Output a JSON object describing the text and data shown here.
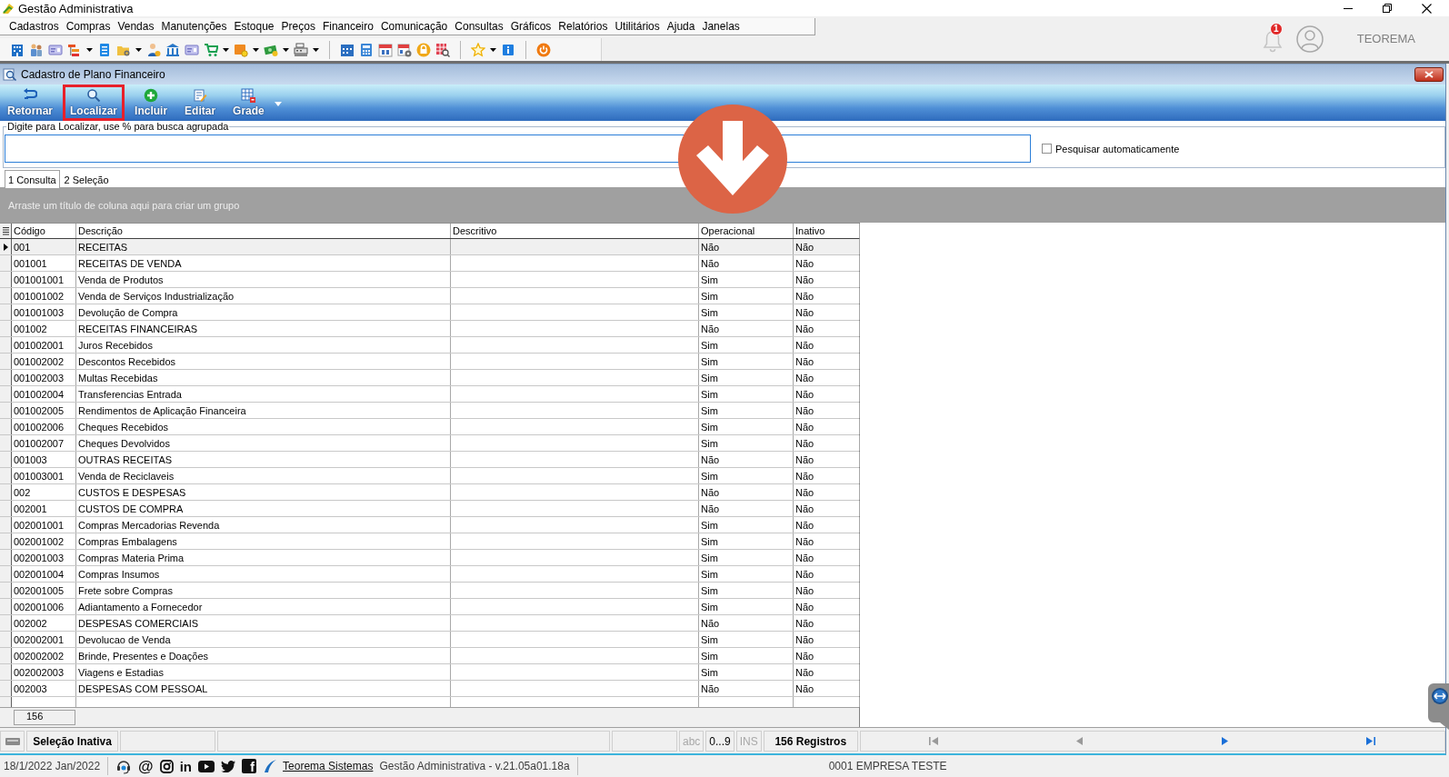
{
  "window": {
    "title": "Gestão Administrativa"
  },
  "menu": [
    "Cadastros",
    "Compras",
    "Vendas",
    "Manutenções",
    "Estoque",
    "Preços",
    "Financeiro",
    "Comunicação",
    "Consultas",
    "Gráficos",
    "Relatórios",
    "Utilitários",
    "Ajuda",
    "Janelas"
  ],
  "account": {
    "notifications": "1",
    "user": "TEOREMA"
  },
  "child_window": {
    "title": "Cadastro de Plano Financeiro"
  },
  "ribbon": [
    {
      "label": "Retornar",
      "highlighted": false,
      "dropdown": false
    },
    {
      "label": "Localizar",
      "highlighted": true,
      "dropdown": false
    },
    {
      "label": "Incluir",
      "highlighted": false,
      "dropdown": false
    },
    {
      "label": "Editar",
      "highlighted": false,
      "dropdown": false
    },
    {
      "label": "Grade",
      "highlighted": false,
      "dropdown": true
    }
  ],
  "search": {
    "legend": "Digite para Localizar, use % para busca agrupada",
    "auto_search": {
      "label": "Pesquisar automaticamente",
      "checked": false
    }
  },
  "tabs": [
    {
      "label": "1 Consulta",
      "selected": true
    },
    {
      "label": "2 Seleção",
      "selected": false
    }
  ],
  "group_panel": {
    "hint": "Arraste um título de coluna aqui para criar um grupo"
  },
  "table": {
    "columns": [
      "Código",
      "Descrição",
      "Descritivo",
      "Operacional",
      "Inativo"
    ],
    "rows": [
      {
        "code": "001",
        "description": "RECEITAS",
        "operational": "Não",
        "inactive": "Não",
        "selected": true
      },
      {
        "code": "001001",
        "description": "RECEITAS DE VENDA",
        "operational": "Não",
        "inactive": "Não",
        "selected": false
      },
      {
        "code": "001001001",
        "description": "Venda de Produtos",
        "operational": "Sim",
        "inactive": "Não",
        "selected": false
      },
      {
        "code": "001001002",
        "description": "Venda de Serviços Industrialização",
        "operational": "Sim",
        "inactive": "Não",
        "selected": false
      },
      {
        "code": "001001003",
        "description": "Devolução de Compra",
        "operational": "Sim",
        "inactive": "Não",
        "selected": false
      },
      {
        "code": "001002",
        "description": "RECEITAS FINANCEIRAS",
        "operational": "Não",
        "inactive": "Não",
        "selected": false
      },
      {
        "code": "001002001",
        "description": "Juros Recebidos",
        "operational": "Sim",
        "inactive": "Não",
        "selected": false
      },
      {
        "code": "001002002",
        "description": "Descontos Recebidos",
        "operational": "Sim",
        "inactive": "Não",
        "selected": false
      },
      {
        "code": "001002003",
        "description": "Multas Recebidas",
        "operational": "Sim",
        "inactive": "Não",
        "selected": false
      },
      {
        "code": "001002004",
        "description": "Transferencias Entrada",
        "operational": "Sim",
        "inactive": "Não",
        "selected": false
      },
      {
        "code": "001002005",
        "description": "Rendimentos de Aplicação Financeira",
        "operational": "Sim",
        "inactive": "Não",
        "selected": false
      },
      {
        "code": "001002006",
        "description": "Cheques Recebidos",
        "operational": "Sim",
        "inactive": "Não",
        "selected": false
      },
      {
        "code": "001002007",
        "description": "Cheques Devolvidos",
        "operational": "Sim",
        "inactive": "Não",
        "selected": false
      },
      {
        "code": "001003",
        "description": "OUTRAS RECEITAS",
        "operational": "Não",
        "inactive": "Não",
        "selected": false
      },
      {
        "code": "001003001",
        "description": "Venda de Reciclaveis",
        "operational": "Sim",
        "inactive": "Não",
        "selected": false
      },
      {
        "code": "002",
        "description": "CUSTOS E DESPESAS",
        "operational": "Não",
        "inactive": "Não",
        "selected": false
      },
      {
        "code": "002001",
        "description": "CUSTOS DE COMPRA",
        "operational": "Não",
        "inactive": "Não",
        "selected": false
      },
      {
        "code": "002001001",
        "description": "Compras Mercadorias Revenda",
        "operational": "Sim",
        "inactive": "Não",
        "selected": false
      },
      {
        "code": "002001002",
        "description": "Compras Embalagens",
        "operational": "Sim",
        "inactive": "Não",
        "selected": false
      },
      {
        "code": "002001003",
        "description": "Compras Materia Prima",
        "operational": "Sim",
        "inactive": "Não",
        "selected": false
      },
      {
        "code": "002001004",
        "description": "Compras Insumos",
        "operational": "Sim",
        "inactive": "Não",
        "selected": false
      },
      {
        "code": "002001005",
        "description": "Frete sobre Compras",
        "operational": "Sim",
        "inactive": "Não",
        "selected": false
      },
      {
        "code": "002001006",
        "description": "Adiantamento a Fornecedor",
        "operational": "Sim",
        "inactive": "Não",
        "selected": false
      },
      {
        "code": "002002",
        "description": "DESPESAS COMERCIAIS",
        "operational": "Não",
        "inactive": "Não",
        "selected": false
      },
      {
        "code": "002002001",
        "description": "Devolucao de Venda",
        "operational": "Sim",
        "inactive": "Não",
        "selected": false
      },
      {
        "code": "002002002",
        "description": "Brinde, Presentes e Doações",
        "operational": "Sim",
        "inactive": "Não",
        "selected": false
      },
      {
        "code": "002002003",
        "description": "Viagens e Estadias",
        "operational": "Sim",
        "inactive": "Não",
        "selected": false
      },
      {
        "code": "002003",
        "description": "DESPESAS COM PESSOAL",
        "operational": "Não",
        "inactive": "Não",
        "selected": false
      }
    ],
    "footer_count": "156"
  },
  "status_bar": {
    "selection": "Seleção Inativa",
    "indicators": [
      {
        "label": "abc",
        "enabled": false
      },
      {
        "label": "0...9",
        "enabled": true
      },
      {
        "label": "INS",
        "enabled": false
      }
    ],
    "records": "156 Registros",
    "nav": [
      {
        "enabled": false
      },
      {
        "enabled": false
      },
      {
        "enabled": true
      },
      {
        "enabled": true
      }
    ]
  },
  "footer": {
    "date": "18/1/2022 Jan/2022",
    "at_mark": "@",
    "in_mark": "in",
    "f_mark": "f",
    "link": "Teorema Sistemas",
    "version": "Gestão Administrativa - v.21.05a01.18a",
    "company": "0001 EMPRESA TESTE"
  }
}
